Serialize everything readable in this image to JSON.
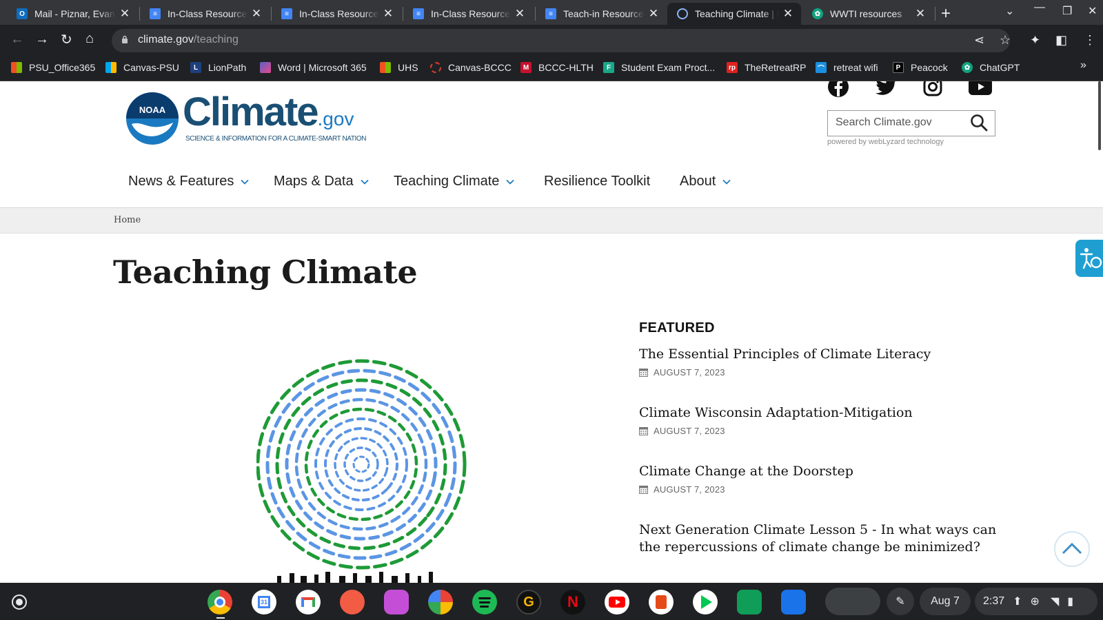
{
  "tabs": [
    {
      "title": "Mail - Piznar, Evan M",
      "icon": "outlook-icon",
      "color": "#0f6cbd"
    },
    {
      "title": "In-Class Resources",
      "icon": "docs-icon",
      "color": "#4285f4"
    },
    {
      "title": "In-Class Resources",
      "icon": "docs-icon",
      "color": "#4285f4"
    },
    {
      "title": "In-Class Resources",
      "icon": "docs-icon",
      "color": "#4285f4"
    },
    {
      "title": "Teach-in Resources",
      "icon": "docs-icon",
      "color": "#4285f4"
    },
    {
      "title": "Teaching Climate | N",
      "icon": "climate-gov-icon",
      "color": "#1a7ac1"
    },
    {
      "title": "WWTI resources",
      "icon": "chatgpt-icon",
      "color": "#10a37f"
    }
  ],
  "address": {
    "host": "climate.gov",
    "path": "/teaching"
  },
  "bookmarks": [
    {
      "label": "PSU_Office365",
      "icon": "microsoft-icon"
    },
    {
      "label": "Canvas-PSU",
      "icon": "microsoft-icon"
    },
    {
      "label": "LionPath",
      "icon": "lionpath-icon"
    },
    {
      "label": "Word | Microsoft 365",
      "icon": "m365-icon"
    },
    {
      "label": "UHS",
      "icon": "microsoft-icon"
    },
    {
      "label": "Canvas-BCCC",
      "icon": "canvas-icon"
    },
    {
      "label": "BCCC-HLTH",
      "icon": "mcgraw-hill-icon"
    },
    {
      "label": "Student Exam Proct...",
      "icon": "proctor-icon"
    },
    {
      "label": "TheRetreatRP",
      "icon": "rp-icon"
    },
    {
      "label": "retreat wifi",
      "icon": "wifi-page-icon"
    },
    {
      "label": "Peacock",
      "icon": "peacock-icon"
    },
    {
      "label": "ChatGPT",
      "icon": "chatgpt-icon"
    }
  ],
  "site": {
    "logo_word": "Climate",
    "logo_suffix": ".gov",
    "logo_badge": "NOAA",
    "tagline": "SCIENCE & INFORMATION FOR A CLIMATE-SMART NATION",
    "search_placeholder": "Search Climate.gov",
    "powered_by": "powered by webLyzard technology",
    "nav": [
      "News & Features",
      "Maps & Data",
      "Teaching Climate",
      "Resilience Toolkit",
      "About"
    ],
    "breadcrumb": "Home",
    "page_title": "Teaching Climate",
    "featured_heading": "FEATURED",
    "featured": [
      {
        "title": "The Essential Principles of Climate Literacy",
        "date": "AUGUST 7, 2023"
      },
      {
        "title": "Climate Wisconsin Adaptation-Mitigation",
        "date": "AUGUST 7, 2023"
      },
      {
        "title": "Climate Change at the Doorstep",
        "date": "AUGUST 7, 2023"
      },
      {
        "title": "Next Generation Climate Lesson 5 - In what ways can the repercussions of climate change be minimized?",
        "date": ""
      }
    ]
  },
  "shelf": {
    "apps": [
      "chrome-icon",
      "calendar-icon",
      "gmail-icon",
      "paint-icon",
      "canvas-app-icon",
      "photos-icon",
      "spotify-icon",
      "grammarly-icon",
      "netflix-icon",
      "youtube-icon",
      "office-icon",
      "play-store-icon",
      "sheets-icon",
      "files-icon"
    ],
    "date": "Aug 7",
    "time": "2:37"
  },
  "colors": {
    "brand_dark": "#1a4f74",
    "brand_light": "#1a7ac1",
    "green_dash": "#1e9a37",
    "blue_dash": "#5b95e4"
  }
}
